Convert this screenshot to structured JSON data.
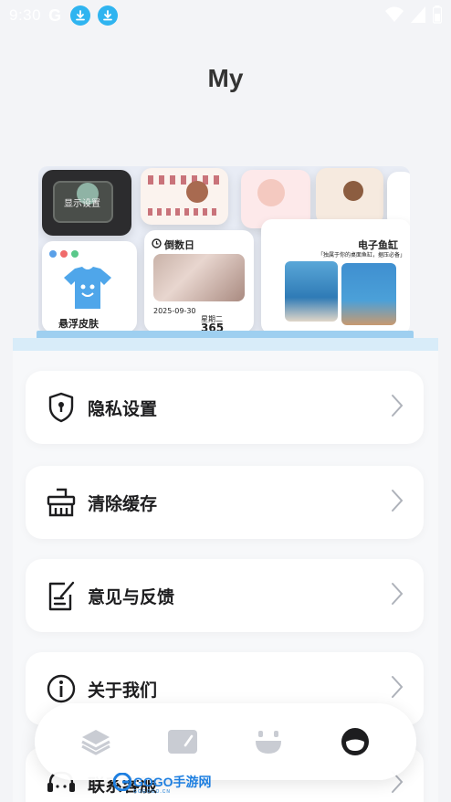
{
  "status_bar": {
    "time": "9:30",
    "carrier_letter": "G",
    "icons": [
      "download-icon",
      "download-icon",
      "wifi-icon",
      "signal-icon",
      "battery-icon"
    ]
  },
  "page": {
    "title": "My"
  },
  "banner": {
    "tile_display": "显示设置",
    "tile_skin": "悬浮皮肤",
    "tile_countdown_title": "倒数日",
    "tile_countdown_date": "2025-09-30",
    "tile_countdown_weekday": "星期二",
    "tile_countdown_days": "365",
    "tile_fish_title": "电子鱼缸",
    "tile_fish_desc": "「独属于你的桌面鱼缸，据压必备」"
  },
  "menu": {
    "items": [
      {
        "label": "隐私设置",
        "icon": "shield-keyhole-icon"
      },
      {
        "label": "清除缓存",
        "icon": "broom-icon"
      },
      {
        "label": "意见与反馈",
        "icon": "note-edit-icon"
      },
      {
        "label": "关于我们",
        "icon": "info-icon"
      },
      {
        "label": "联系客服",
        "icon": "headset-icon"
      }
    ]
  },
  "bottom_nav": {
    "items": [
      {
        "icon": "layers-icon",
        "active": false
      },
      {
        "icon": "widget-card-icon",
        "active": false
      },
      {
        "icon": "face-icon",
        "active": false
      },
      {
        "icon": "profile-face-icon",
        "active": true
      }
    ]
  },
  "watermark": {
    "text": "GOGO手游网",
    "sub": "GOGOGO.CN"
  },
  "colors": {
    "accent_blue": "#2fb4f0",
    "inactive_nav": "#c9ccd3",
    "active_nav": "#1d1d1f"
  }
}
